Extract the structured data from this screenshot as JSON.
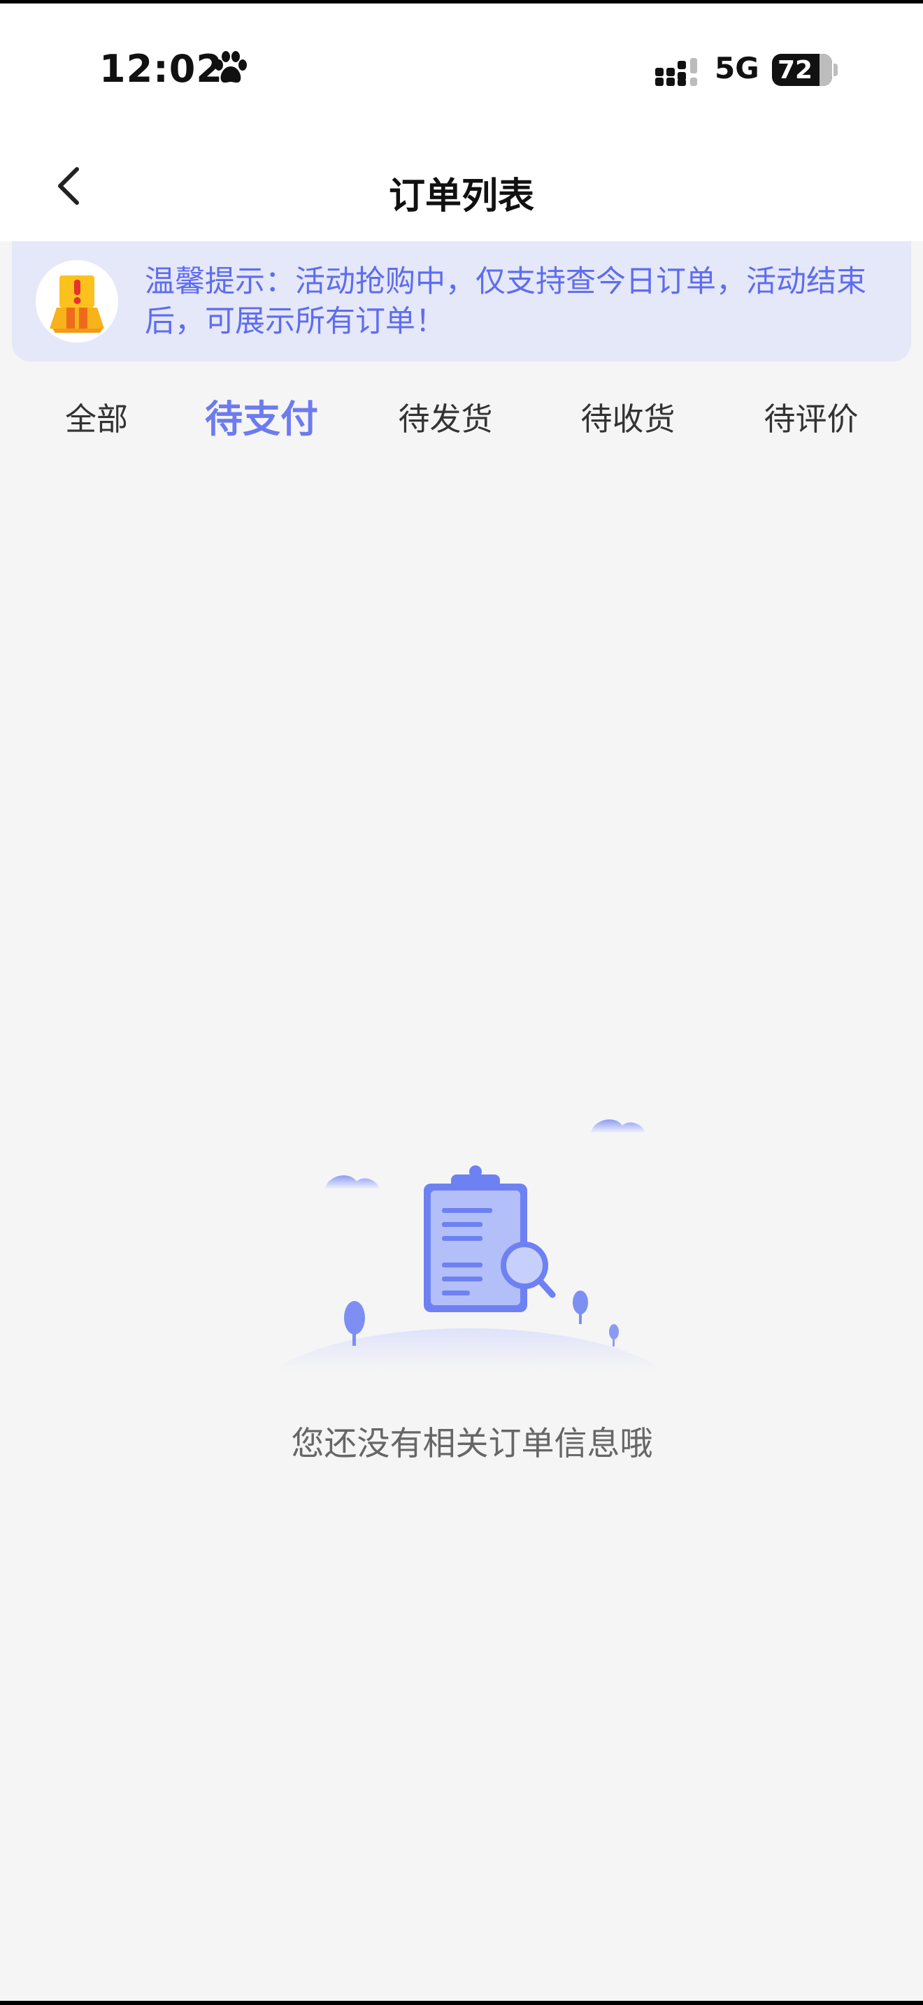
{
  "status_bar": {
    "time": "12:02",
    "network": "5G",
    "battery": "72",
    "icons": [
      "paw-icon",
      "signal-icon",
      "battery-icon"
    ]
  },
  "nav": {
    "title": "订单列表",
    "back_icon": "chevron-left-icon"
  },
  "notice": {
    "icon": "warning-sign-icon",
    "text": "温馨提示：活动抢购中，仅支持查今日订单，活动结束后，可展示所有订单！"
  },
  "tabs": [
    {
      "label": "全部",
      "active": false
    },
    {
      "label": "待支付",
      "active": true
    },
    {
      "label": "待发货",
      "active": false
    },
    {
      "label": "待收货",
      "active": false
    },
    {
      "label": "待评价",
      "active": false
    }
  ],
  "empty_state": {
    "illustration": "clipboard-search-illustration",
    "message": "您还没有相关订单信息哦"
  },
  "colors": {
    "accent": "#6c7bf0",
    "notice_bg": "#e5e8f8",
    "page_bg": "#f5f5f5"
  }
}
